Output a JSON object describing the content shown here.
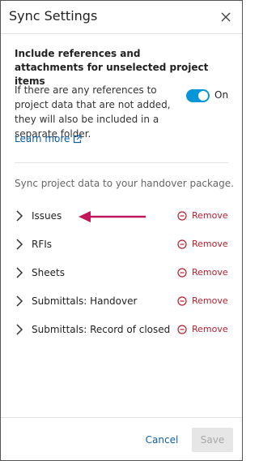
{
  "dialog": {
    "title": "Sync Settings",
    "close_icon": "close-icon"
  },
  "references": {
    "heading": "Include references and attachments for unselected project items",
    "description": "If there are any references to project data that are not added, they will also be included in a separate folder.",
    "toggle_state": "On",
    "toggle_color": "#0696d7",
    "learn_more_label": "Learn more",
    "learn_more_icon": "external-link-icon"
  },
  "sync": {
    "description": "Sync project data to your handover package.",
    "items": [
      {
        "label": "Issues",
        "remove_label": "Remove"
      },
      {
        "label": "RFIs",
        "remove_label": "Remove"
      },
      {
        "label": "Sheets",
        "remove_label": "Remove"
      },
      {
        "label": "Submittals: Handover",
        "remove_label": "Remove"
      },
      {
        "label": "Submittals: Record of closed",
        "remove_label": "Remove"
      }
    ],
    "remove_color": "#b5202e",
    "annotation_arrow_color": "#c2185b"
  },
  "footer": {
    "cancel_label": "Cancel",
    "save_label": "Save"
  }
}
